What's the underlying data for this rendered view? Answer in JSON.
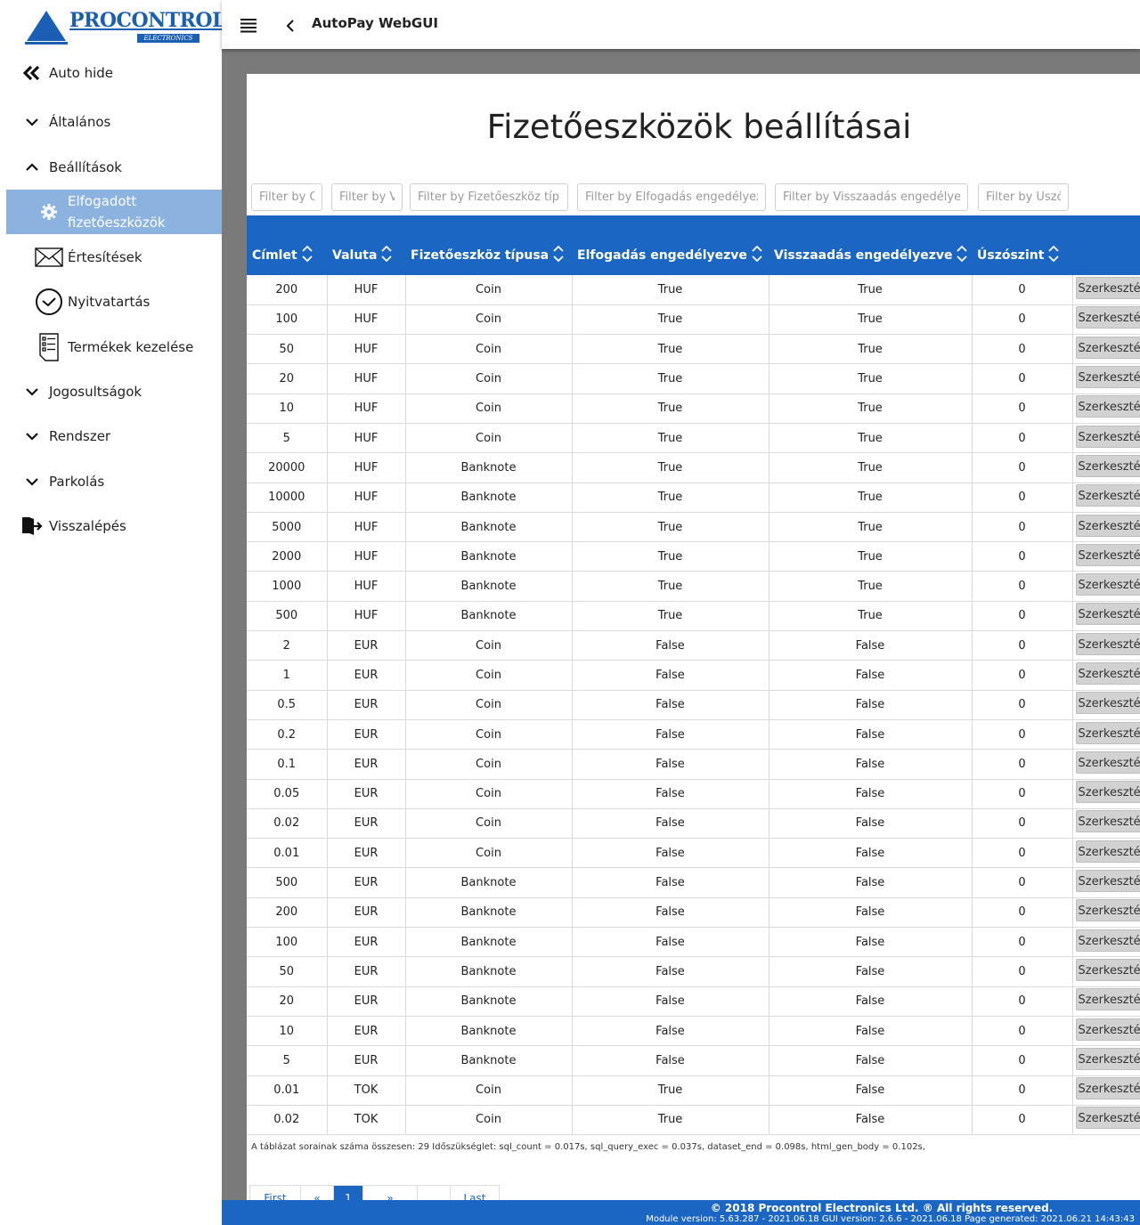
{
  "brand": {
    "name": "PROCONTROL",
    "sub": "ELECTRONICS"
  },
  "app_title": "AutoPay WebGUI",
  "sidebar": {
    "auto_hide": "Auto hide",
    "items": [
      {
        "label": "Általános",
        "icon": "chevron-down-icon"
      },
      {
        "label": "Beállítások",
        "icon": "chevron-up-icon"
      },
      {
        "label": "Elfogadott\nfizetőeszközök",
        "icon": "gear-icon"
      },
      {
        "label": "Értesítések",
        "icon": "envelope-icon"
      },
      {
        "label": "Nyitvatartás",
        "icon": "clock-icon"
      },
      {
        "label": "Termékek kezelése",
        "icon": "document-list-icon"
      },
      {
        "label": "Jogosultságok",
        "icon": "chevron-down-icon"
      },
      {
        "label": "Rendszer",
        "icon": "chevron-down-icon"
      },
      {
        "label": "Parkolás",
        "icon": "chevron-down-icon"
      },
      {
        "label": "Visszalépés",
        "icon": "exit-door-icon"
      }
    ]
  },
  "page_title": "Fizetőeszközök beállításai",
  "filters": {
    "cimlet": "Filter by C",
    "valuta": "Filter by V",
    "tipus": "Filter by Fizetőeszköz típu",
    "elfogadas": "Filter by Elfogadás engedélyezv",
    "visszaadas": "Filter by Visszaadás engedélyezv",
    "uszo": "Filter by Úszó"
  },
  "table": {
    "headers": [
      "Címlet",
      "Valuta",
      "Fizetőeszköz típusa",
      "Elfogadás engedélyezve",
      "Visszaadás engedélyezve",
      "Úszószint",
      ""
    ],
    "edit_label": "Szerkesztés",
    "rows": [
      [
        "200",
        "HUF",
        "Coin",
        "True",
        "True",
        "0"
      ],
      [
        "100",
        "HUF",
        "Coin",
        "True",
        "True",
        "0"
      ],
      [
        "50",
        "HUF",
        "Coin",
        "True",
        "True",
        "0"
      ],
      [
        "20",
        "HUF",
        "Coin",
        "True",
        "True",
        "0"
      ],
      [
        "10",
        "HUF",
        "Coin",
        "True",
        "True",
        "0"
      ],
      [
        "5",
        "HUF",
        "Coin",
        "True",
        "True",
        "0"
      ],
      [
        "20000",
        "HUF",
        "Banknote",
        "True",
        "True",
        "0"
      ],
      [
        "10000",
        "HUF",
        "Banknote",
        "True",
        "True",
        "0"
      ],
      [
        "5000",
        "HUF",
        "Banknote",
        "True",
        "True",
        "0"
      ],
      [
        "2000",
        "HUF",
        "Banknote",
        "True",
        "True",
        "0"
      ],
      [
        "1000",
        "HUF",
        "Banknote",
        "True",
        "True",
        "0"
      ],
      [
        "500",
        "HUF",
        "Banknote",
        "True",
        "True",
        "0"
      ],
      [
        "2",
        "EUR",
        "Coin",
        "False",
        "False",
        "0"
      ],
      [
        "1",
        "EUR",
        "Coin",
        "False",
        "False",
        "0"
      ],
      [
        "0.5",
        "EUR",
        "Coin",
        "False",
        "False",
        "0"
      ],
      [
        "0.2",
        "EUR",
        "Coin",
        "False",
        "False",
        "0"
      ],
      [
        "0.1",
        "EUR",
        "Coin",
        "False",
        "False",
        "0"
      ],
      [
        "0.05",
        "EUR",
        "Coin",
        "False",
        "False",
        "0"
      ],
      [
        "0.02",
        "EUR",
        "Coin",
        "False",
        "False",
        "0"
      ],
      [
        "0.01",
        "EUR",
        "Coin",
        "False",
        "False",
        "0"
      ],
      [
        "500",
        "EUR",
        "Banknote",
        "False",
        "False",
        "0"
      ],
      [
        "200",
        "EUR",
        "Banknote",
        "False",
        "False",
        "0"
      ],
      [
        "100",
        "EUR",
        "Banknote",
        "False",
        "False",
        "0"
      ],
      [
        "50",
        "EUR",
        "Banknote",
        "False",
        "False",
        "0"
      ],
      [
        "20",
        "EUR",
        "Banknote",
        "False",
        "False",
        "0"
      ],
      [
        "10",
        "EUR",
        "Banknote",
        "False",
        "False",
        "0"
      ],
      [
        "5",
        "EUR",
        "Banknote",
        "False",
        "False",
        "0"
      ],
      [
        "0.01",
        "TOK",
        "Coin",
        "True",
        "False",
        "0"
      ],
      [
        "0.02",
        "TOK",
        "Coin",
        "True",
        "False",
        "0"
      ]
    ]
  },
  "stats": "A táblázat sorainak száma összesen: 29   Időszükséglet: sql_count = 0.017s, sql_query_exec = 0.037s, dataset_end = 0.098s, html_gen_body = 0.102s,",
  "pagination": {
    "first": "First",
    "prev": "«",
    "current": "1",
    "next": "»",
    "last": "Last"
  },
  "footer": {
    "copyright": "© 2018 Procontrol Electronics Ltd. ® All rights reserved.",
    "versions": "Module version: 5.63.287 - 2021.06.18    GUI version: 2.6.6 - 2021.06.18    Page generated: 2021.06.21 14:43:43"
  },
  "colors": {
    "primary": "#1b66c2",
    "sidebar_active": "#8cb3df",
    "background": "#7a7a7a"
  }
}
